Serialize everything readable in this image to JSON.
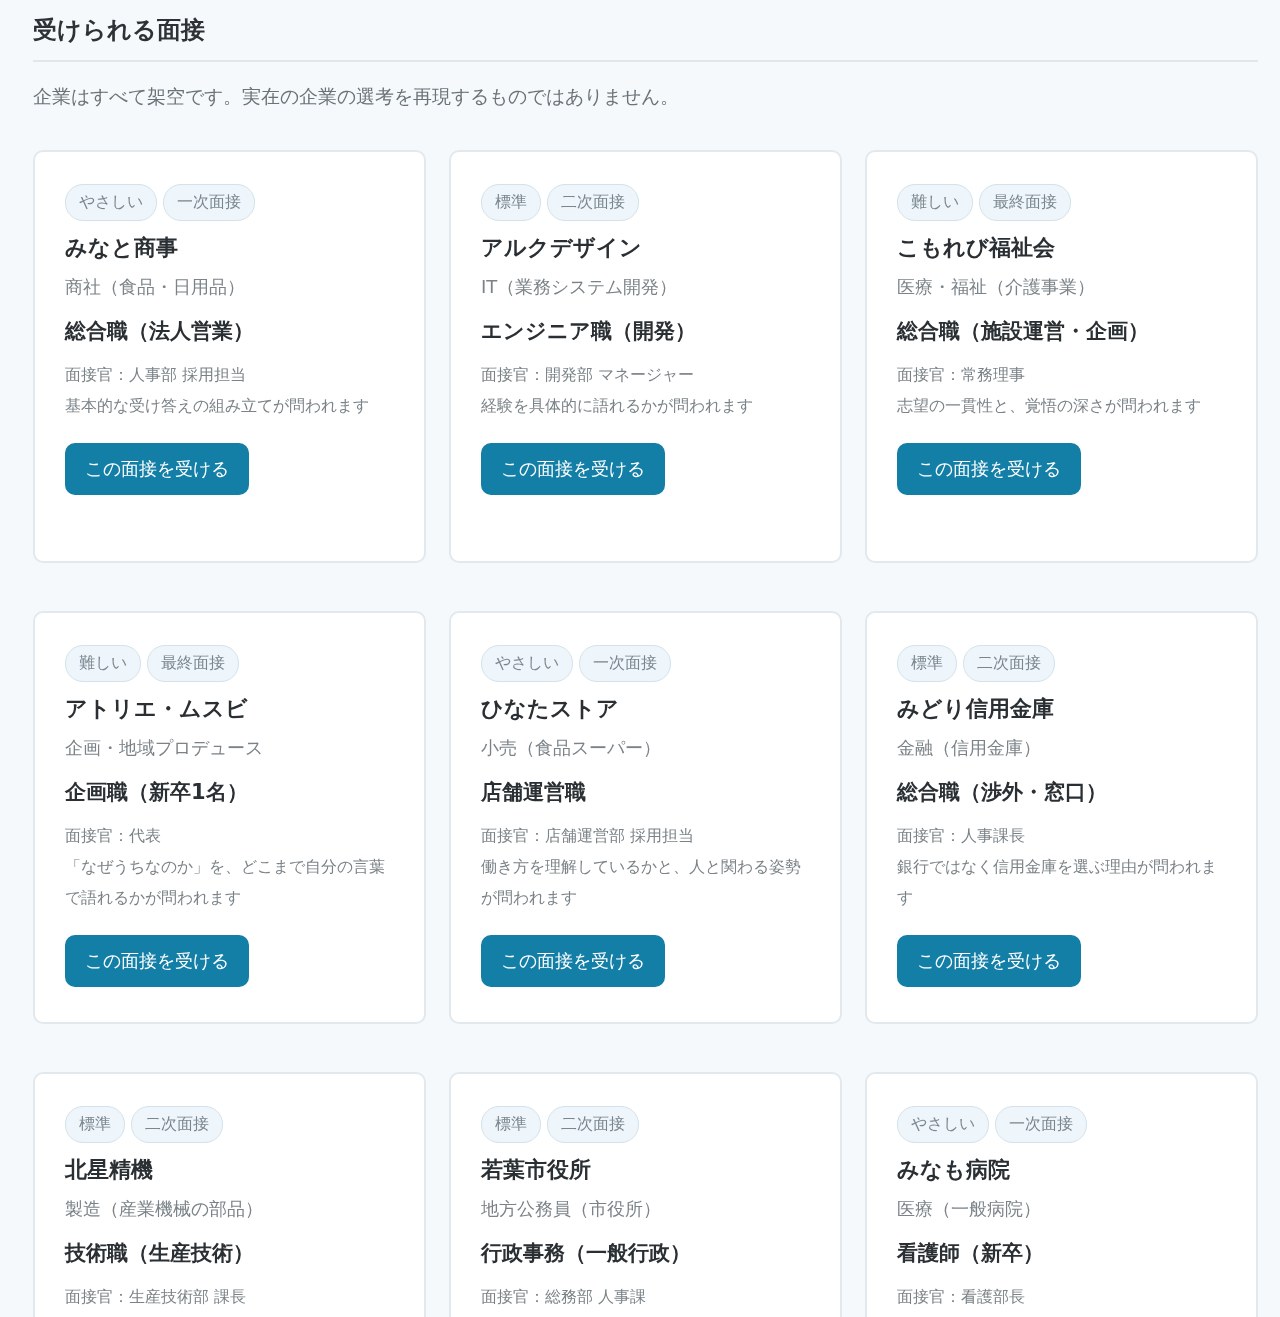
{
  "title": "受けられる面接",
  "note": "企業はすべて架空です。実在の企業の選考を再現するものではありません。",
  "cards": [
    {
      "tags": [
        "やさしい",
        "一次面接"
      ],
      "company": "みなと商事",
      "industry": "商社（食品・日用品）",
      "role": "総合職（法人営業）",
      "interviewer": "面接官：人事部 採用担当",
      "focus": "基本的な受け答えの組み立てが問われます",
      "button": "この面接を受ける"
    },
    {
      "tags": [
        "標準",
        "二次面接"
      ],
      "company": "アルクデザイン",
      "industry": "IT（業務システム開発）",
      "role": "エンジニア職（開発）",
      "interviewer": "面接官：開発部 マネージャー",
      "focus": "経験を具体的に語れるかが問われます",
      "button": "この面接を受ける"
    },
    {
      "tags": [
        "難しい",
        "最終面接"
      ],
      "company": "こもれび福祉会",
      "industry": "医療・福祉（介護事業）",
      "role": "総合職（施設運営・企画）",
      "interviewer": "面接官：常務理事",
      "focus": "志望の一貫性と、覚悟の深さが問われます",
      "button": "この面接を受ける"
    },
    {
      "tags": [
        "難しい",
        "最終面接"
      ],
      "company": "アトリエ・ムスビ",
      "industry": "企画・地域プロデュース",
      "role": "企画職（新卒1名）",
      "interviewer": "面接官：代表",
      "focus": "「なぜうちなのか」を、どこまで自分の言葉で語れるかが問われます",
      "button": "この面接を受ける"
    },
    {
      "tags": [
        "やさしい",
        "一次面接"
      ],
      "company": "ひなたストア",
      "industry": "小売（食品スーパー）",
      "role": "店舗運営職",
      "interviewer": "面接官：店舗運営部 採用担当",
      "focus": "働き方を理解しているかと、人と関わる姿勢が問われます",
      "button": "この面接を受ける"
    },
    {
      "tags": [
        "標準",
        "二次面接"
      ],
      "company": "みどり信用金庫",
      "industry": "金融（信用金庫）",
      "role": "総合職（渉外・窓口）",
      "interviewer": "面接官：人事課長",
      "focus": "銀行ではなく信用金庫を選ぶ理由が問われます",
      "button": "この面接を受ける"
    },
    {
      "tags": [
        "標準",
        "二次面接"
      ],
      "company": "北星精機",
      "industry": "製造（産業機械の部品）",
      "role": "技術職（生産技術）",
      "interviewer": "面接官：生産技術部 課長"
    },
    {
      "tags": [
        "標準",
        "二次面接"
      ],
      "company": "若葉市役所",
      "industry": "地方公務員（市役所）",
      "role": "行政事務（一般行政）",
      "interviewer": "面接官：総務部 人事課"
    },
    {
      "tags": [
        "やさしい",
        "一次面接"
      ],
      "company": "みなも病院",
      "industry": "医療（一般病院）",
      "role": "看護師（新卒）",
      "interviewer": "面接官：看護部長"
    }
  ]
}
